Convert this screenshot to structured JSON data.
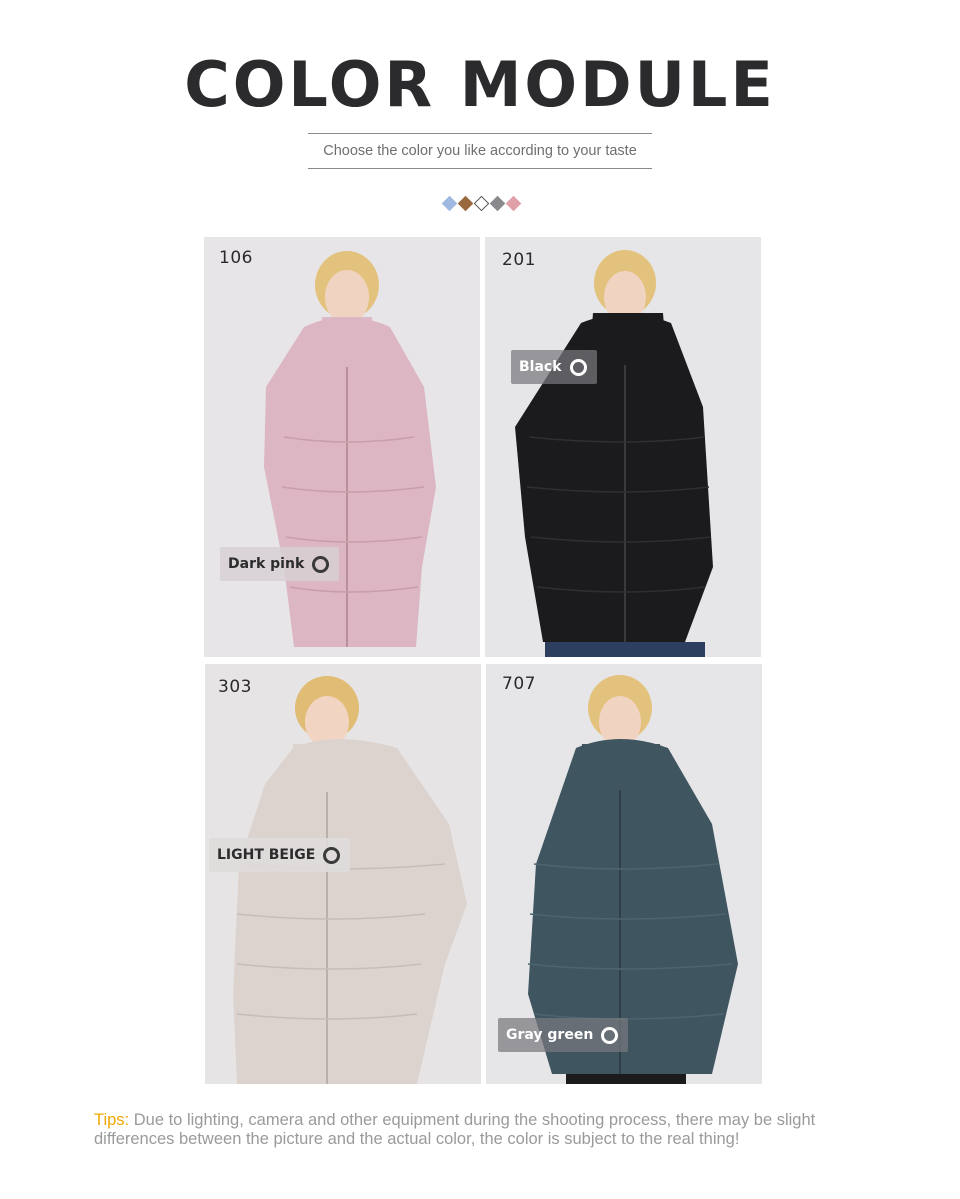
{
  "header": {
    "title": "COLOR MODULE",
    "subtitle": "Choose the color you like according to your taste"
  },
  "swatches": [
    "#9fb9e0",
    "#9a6a3e",
    "#ffffff",
    "#8a8a8e",
    "#e0a0a8"
  ],
  "products": [
    {
      "code": "106",
      "color_name": "Dark pink",
      "coat_color": "#dcb6c2"
    },
    {
      "code": "201",
      "color_name": "Black",
      "coat_color": "#1b1b1d"
    },
    {
      "code": "303",
      "color_name": "LIGHT BEIGE",
      "coat_color": "#dcd3cf"
    },
    {
      "code": "707",
      "color_name": "Gray green",
      "coat_color": "#3f5560"
    }
  ],
  "tips": {
    "label": "Tips:",
    "text": "Due to lighting, camera and other equipment during the shooting process, there may be slight differences between the picture and the actual color, the color is subject to the real thing!"
  }
}
